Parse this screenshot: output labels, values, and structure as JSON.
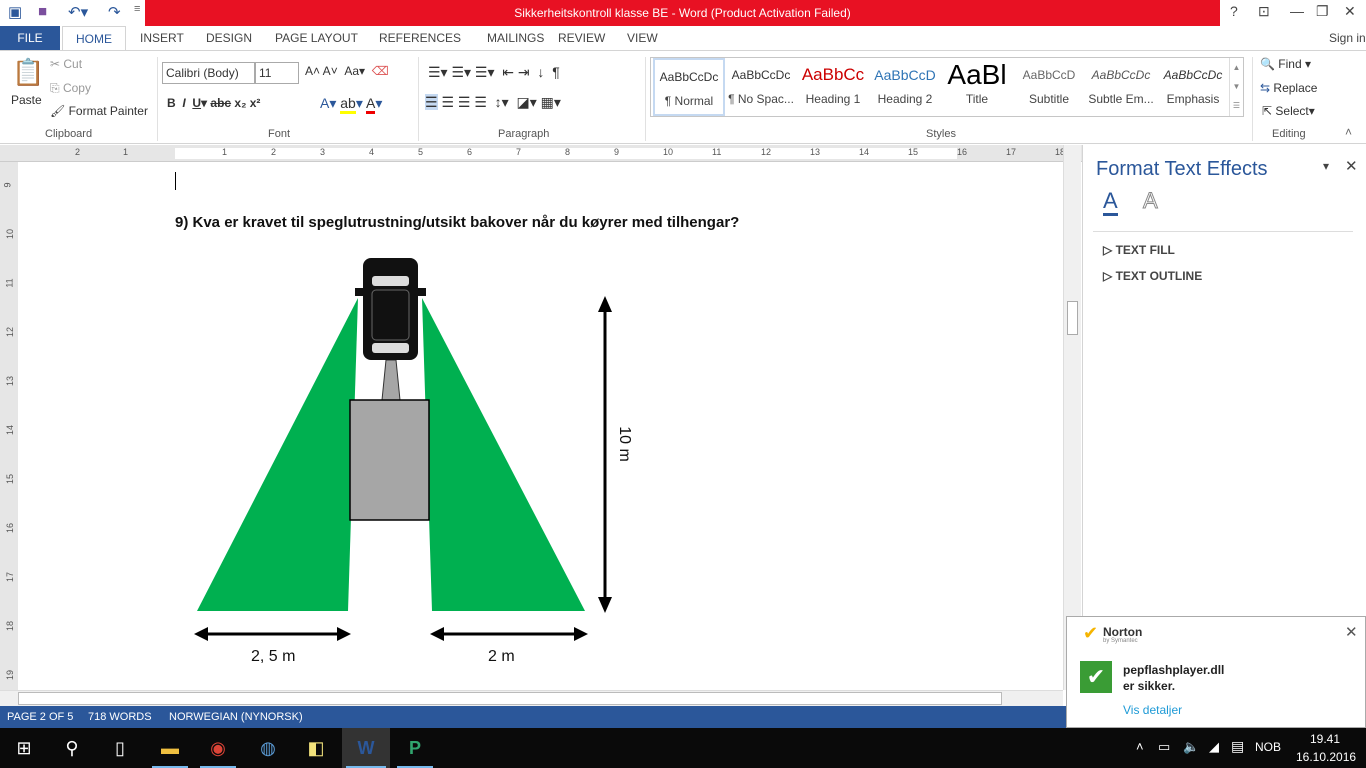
{
  "window": {
    "title": "Sikkerheitskontroll klasse BE -  Word (Product Activation Failed)",
    "sign_in": "Sign in",
    "help": "?"
  },
  "tabs": [
    "FILE",
    "HOME",
    "INSERT",
    "DESIGN",
    "PAGE LAYOUT",
    "REFERENCES",
    "MAILINGS",
    "REVIEW",
    "VIEW"
  ],
  "clipboard": {
    "paste": "Paste",
    "cut": "Cut",
    "copy": "Copy",
    "format_painter": "Format Painter",
    "label": "Clipboard"
  },
  "font": {
    "name": "Calibri (Body)",
    "size": "11",
    "label": "Font"
  },
  "paragraph": {
    "label": "Paragraph"
  },
  "styles": {
    "items": [
      {
        "preview": "AaBbCcDc",
        "name": "¶ Normal"
      },
      {
        "preview": "AaBbCcDc",
        "name": "¶ No Spac..."
      },
      {
        "preview": "AaBbCc",
        "name": "Heading 1"
      },
      {
        "preview": "AaBbCcD",
        "name": "Heading 2"
      },
      {
        "preview": "AaBl",
        "name": "Title"
      },
      {
        "preview": "AaBbCcD",
        "name": "Subtitle"
      },
      {
        "preview": "AaBbCcDc",
        "name": "Subtle Em..."
      },
      {
        "preview": "AaBbCcDc",
        "name": "Emphasis"
      }
    ],
    "label": "Styles"
  },
  "editing": {
    "find": "Find",
    "replace": "Replace",
    "select": "Select",
    "label": "Editing"
  },
  "document": {
    "question": "9)  Kva er kravet til speglutrustning/utsikt bakover når du køyrer med tilhengar?",
    "dim_height": "10 m",
    "dim_left": "2, 5 m",
    "dim_right": "2 m",
    "colors": {
      "view_area": "#00b050",
      "trailer": "#a6a6a6"
    }
  },
  "pane": {
    "title": "Format Text Effects",
    "sections": [
      "TEXT FILL",
      "TEXT OUTLINE"
    ]
  },
  "status": {
    "page": "PAGE 2 OF 5",
    "words": "718 WORDS",
    "language": "NORWEGIAN (NYNORSK)"
  },
  "norton": {
    "brand": "Norton",
    "sub": "by Symantec",
    "line1": "pepflashplayer.dll",
    "line2": "er sikker.",
    "link": "Vis detaljer"
  },
  "tray": {
    "lang": "NOB",
    "time": "19.41",
    "date": "16.10.2016"
  },
  "ruler_h": [
    "2",
    "1",
    "1",
    "2",
    "3",
    "4",
    "5",
    "6",
    "7",
    "8",
    "9",
    "10",
    "11",
    "12",
    "13",
    "14",
    "15",
    "16",
    "17",
    "18"
  ],
  "ruler_v": [
    "9",
    "10",
    "11",
    "12",
    "13",
    "14",
    "15",
    "16",
    "17",
    "18",
    "19"
  ]
}
